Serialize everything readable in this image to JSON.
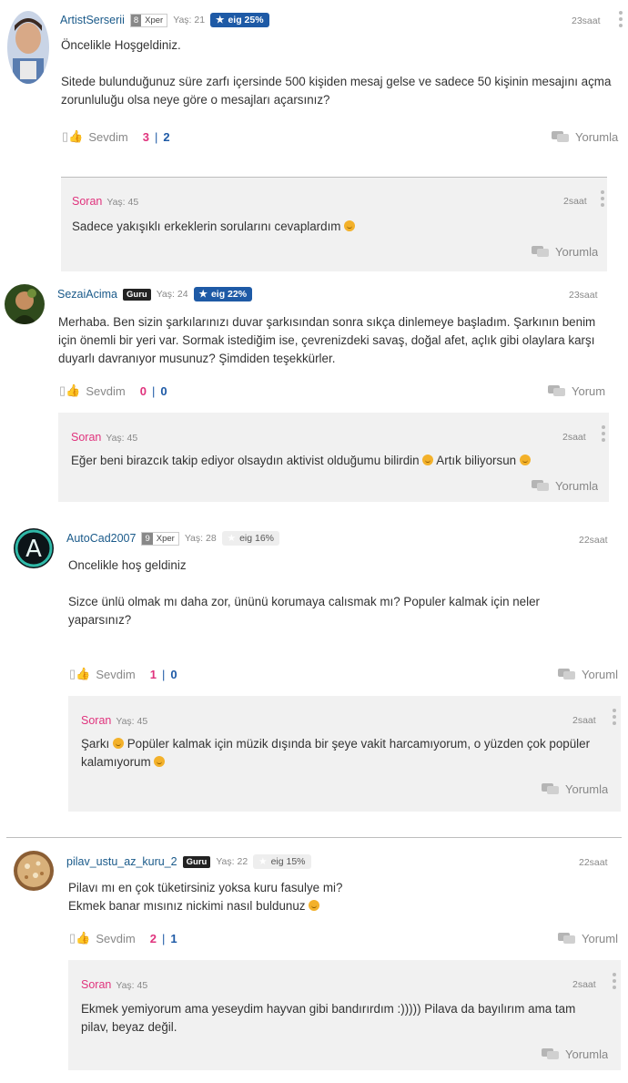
{
  "questions": [
    {
      "user": "ArtistSerserii",
      "level": "8",
      "level_label": "Xper",
      "age": "Yaş: 21",
      "eig": "eig 25%",
      "time": "23saat",
      "paragraphs": [
        "Öncelikle Hoşgeldiniz.",
        "Sitede bulunduğunuz süre zarfı içersinde 500 kişiden mesaj gelse ve sadece 50 kişinin mesajını açma zorunluluğu olsa neye göre o mesajları açarsınız?"
      ],
      "like_label": "Sevdim",
      "likes": "3",
      "sep": "|",
      "dislikes": "2",
      "reply_label": "Yorumla",
      "answer": {
        "author": "Soran",
        "age": "Yaş: 45",
        "time": "2saat",
        "text": "Sadece yakışıklı erkeklerin sorularını cevaplardım",
        "reply_label": "Yorumla"
      }
    },
    {
      "user": "SezaiAcima",
      "badge": "Guru",
      "age": "Yaş: 24",
      "eig": "eig 22%",
      "time": "23saat",
      "paragraphs": [
        "Merhaba. Ben sizin şarkılarınızı duvar şarkısından sonra sıkça dinlemeye başladım. Şarkının benim için önemli bir yeri var. Sormak istediğim ise, çevrenizdeki savaş, doğal afet, açlık gibi olaylara karşı duyarlı davranıyor musunuz? Şimdiden teşekkürler."
      ],
      "like_label": "Sevdim",
      "likes": "0",
      "sep": "|",
      "dislikes": "0",
      "reply_label": "Yorum",
      "answer": {
        "author": "Soran",
        "age": "Yaş: 45",
        "time": "2saat",
        "text_a": "Eğer beni birazcık takip ediyor olsaydın aktivist olduğumu bilirdin",
        "text_b": "Artık biliyorsun",
        "reply_label": "Yorumla"
      }
    },
    {
      "user": "AutoCad2007",
      "level": "9",
      "level_label": "Xper",
      "age": "Yaş: 28",
      "eig": "eig 16%",
      "time": "22saat",
      "paragraphs": [
        "Oncelikle hoş geldiniz",
        "Sizce ünlü olmak mı daha zor, ününü korumaya calısmak mı? Populer kalmak için neler yaparsınız?"
      ],
      "like_label": "Sevdim",
      "likes": "1",
      "sep": "|",
      "dislikes": "0",
      "reply_label": "Yoruml",
      "answer": {
        "author": "Soran",
        "age": "Yaş: 45",
        "time": "2saat",
        "text_a": "Şarkı",
        "text_b": "Popüler kalmak için müzik dışında bir şeye vakit harcamıyorum, o yüzden çok popüler kalamıyorum",
        "reply_label": "Yorumla"
      }
    },
    {
      "user": "pilav_ustu_az_kuru_2",
      "badge": "Guru",
      "age": "Yaş: 22",
      "eig": "eig 15%",
      "time": "22saat",
      "lines": [
        "Pilavı mı en çok tüketirsiniz yoksa kuru fasulye mi?",
        "Ekmek banar mısınız nickimi nasıl buldunuz"
      ],
      "like_label": "Sevdim",
      "likes": "2",
      "sep": "|",
      "dislikes": "1",
      "reply_label": "Yoruml",
      "answer": {
        "author": "Soran",
        "age": "Yaş: 45",
        "time": "2saat",
        "text": "Ekmek yemiyorum ama yeseydim hayvan gibi bandırırdım :))))) Pilava da bayılırım ama tam pilav, beyaz değil.",
        "reply_label": "Yorumla"
      }
    }
  ],
  "colors": {
    "username": "#1a5a8a",
    "soran": "#e0337d",
    "eig_badge": "#1e5aa6",
    "reply_bg": "#f1f1f1"
  },
  "icons": [
    "thumbs-up-icon",
    "chat-bubble-icon",
    "star-icon",
    "kebab-menu-icon",
    "smiley-emoji-icon"
  ]
}
